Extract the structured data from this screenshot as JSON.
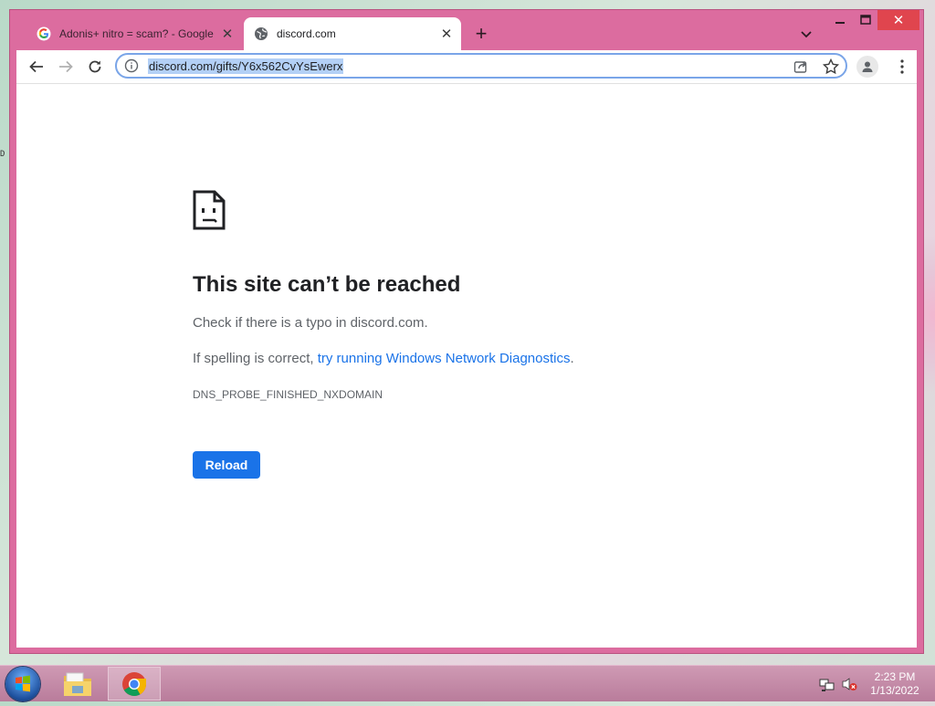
{
  "browser": {
    "tabs": [
      {
        "title": "Adonis+ nitro = scam? - Google",
        "active": false,
        "icon": "google-g-icon"
      },
      {
        "title": "discord.com",
        "active": true,
        "icon": "globe-icon"
      }
    ],
    "new_tab_symbol": "+",
    "address_bar": {
      "url": "discord.com/gifts/Y6x562CvYsEwerx",
      "selected": true
    },
    "accent_color": "#dc6c9f"
  },
  "error_page": {
    "heading": "This site can’t be reached",
    "message_1": "Check if there is a typo in discord.com.",
    "message_2_prefix": "If spelling is correct, ",
    "message_2_link": "try running Windows Network Diagnostics",
    "message_2_suffix": ".",
    "error_code": "DNS_PROBE_FINISHED_NXDOMAIN",
    "reload_label": "Reload",
    "button_color": "#1a73e8"
  },
  "taskbar": {
    "apps": [
      "file-explorer-icon",
      "chrome-icon"
    ],
    "clock_time": "2:23 PM",
    "clock_date": "1/13/2022"
  }
}
